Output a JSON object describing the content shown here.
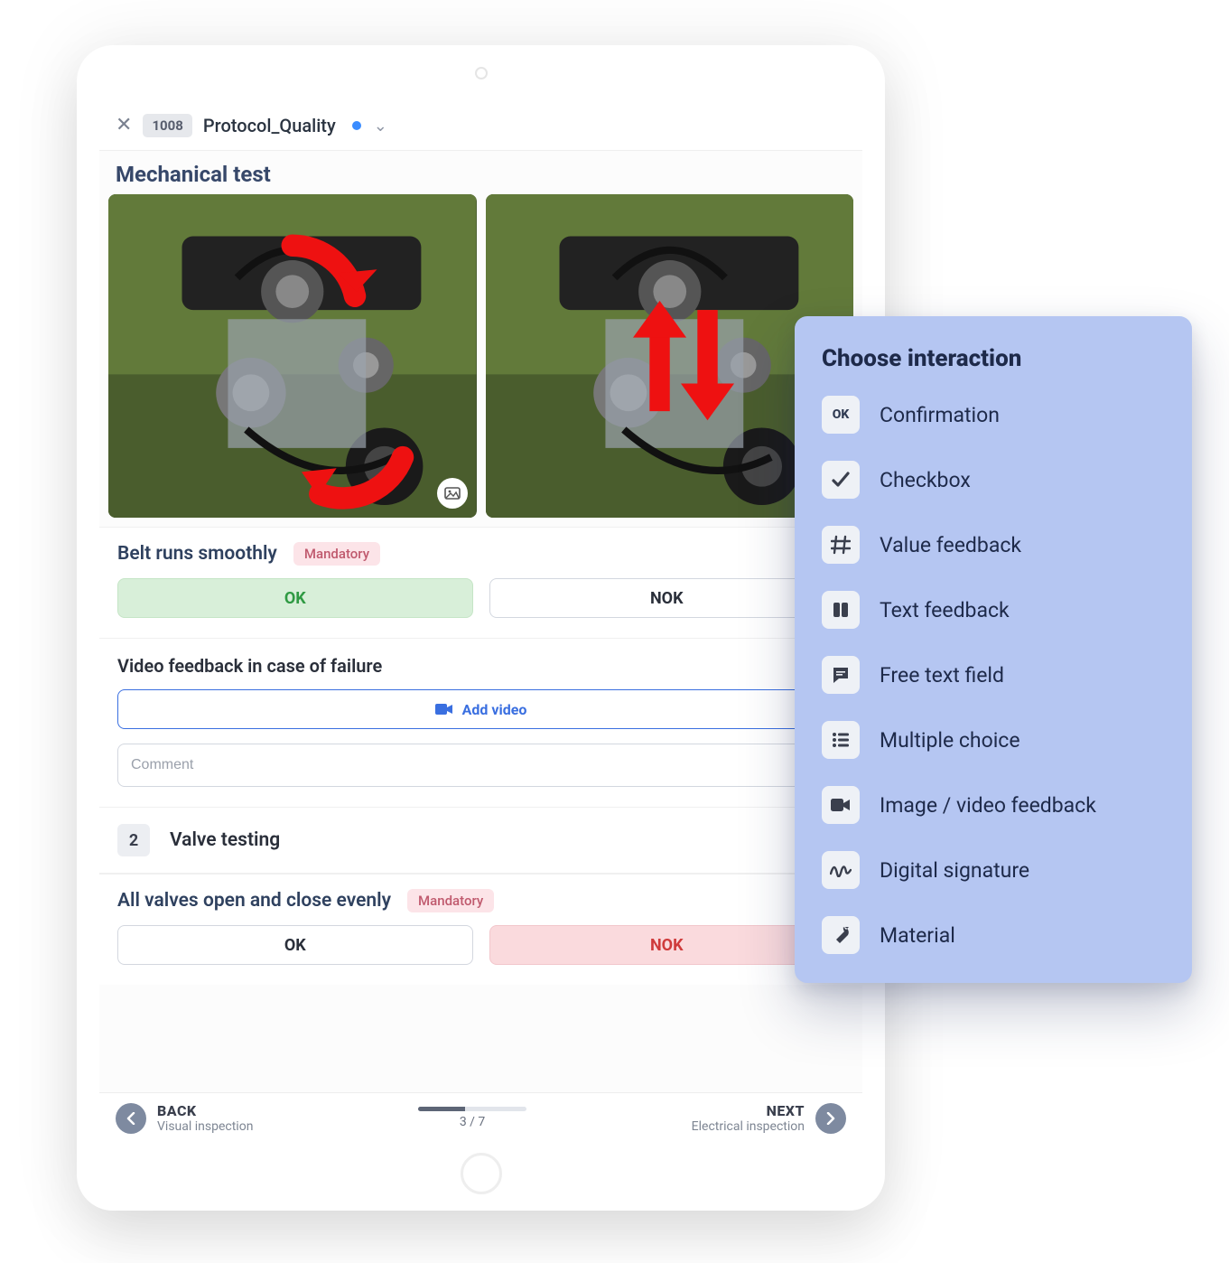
{
  "header": {
    "protocol_id": "1008",
    "protocol_name": "Protocol_Quality"
  },
  "section": {
    "title": "Mechanical test"
  },
  "checks": [
    {
      "label": "Belt runs smoothly",
      "mandatory_label": "Mandatory",
      "ok_label": "OK",
      "nok_label": "NOK",
      "selected": "ok"
    },
    {
      "label": "All valves open and close evenly",
      "mandatory_label": "Mandatory",
      "ok_label": "OK",
      "nok_label": "NOK",
      "selected": "nok"
    }
  ],
  "video_block": {
    "label": "Video feedback in case of failure",
    "add_label": "Add video",
    "comment_placeholder": "Comment"
  },
  "step": {
    "number": "2",
    "title": "Valve testing"
  },
  "progress": {
    "back_label": "BACK",
    "back_sub": "Visual inspection",
    "page_text": "3 / 7",
    "next_label": "NEXT",
    "next_sub": "Electrical inspection",
    "percent": 43
  },
  "popover": {
    "title": "Choose interaction",
    "items": [
      {
        "icon": "ok-text",
        "label": "Confirmation"
      },
      {
        "icon": "check",
        "label": "Checkbox"
      },
      {
        "icon": "hash",
        "label": "Value feedback"
      },
      {
        "icon": "columns",
        "label": "Text feedback"
      },
      {
        "icon": "message",
        "label": "Free text field"
      },
      {
        "icon": "list",
        "label": "Multiple choice"
      },
      {
        "icon": "camera",
        "label": "Image / video feedback"
      },
      {
        "icon": "signature",
        "label": "Digital signature"
      },
      {
        "icon": "wrench",
        "label": "Material"
      }
    ]
  }
}
